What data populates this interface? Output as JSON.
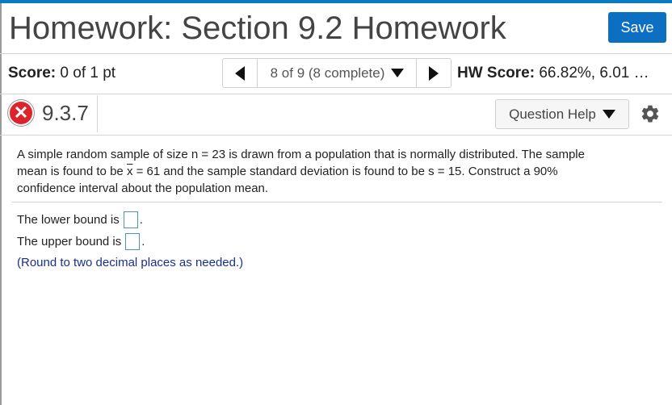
{
  "header": {
    "title": "Homework: Section 9.2 Homework",
    "save_label": "Save",
    "accent_color": "#0d6fc2"
  },
  "scorebar": {
    "score_label": "Score:",
    "score_value": "0 of 1 pt",
    "nav_selector": "8 of 9 (8 complete)",
    "hw_score_label": "HW Score:",
    "hw_score_value": "66.82%, 6.01 …"
  },
  "question": {
    "number": "9.3.7",
    "status_icon": "incorrect-x-icon",
    "help_label": "Question Help",
    "settings_icon": "gear-icon"
  },
  "problem": {
    "line1": "A simple random sample of size n = 23 is drawn from a population that is normally distributed. The sample",
    "line2_pre": "mean is found to be ",
    "line2_xbar": "x",
    "line2_post": " = 61 and the sample standard deviation is found to be s = 15. Construct a 90%",
    "line3": "confidence interval about the population mean."
  },
  "answers": {
    "lower_label": "The lower bound is",
    "lower_value": "",
    "upper_label": "The upper bound is",
    "upper_value": "",
    "period": "."
  },
  "hint": "(Round to two decimal places as needed.)"
}
